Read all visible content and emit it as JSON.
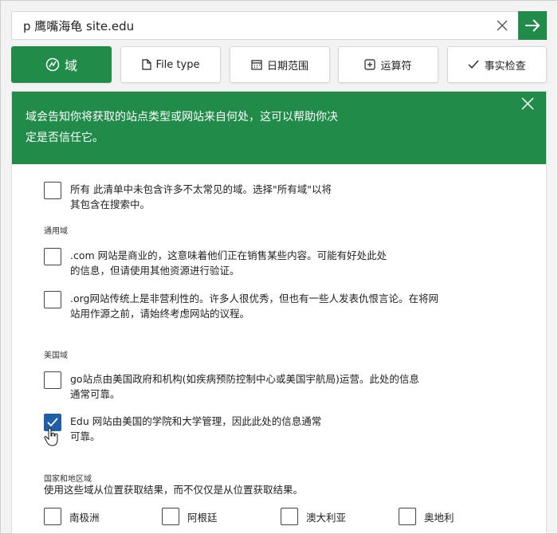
{
  "search": {
    "query": "p 鹰嘴海龟 site.edu"
  },
  "filters": [
    {
      "label": "域",
      "icon": "domain-icon"
    },
    {
      "label": "File type",
      "icon": "file-icon"
    },
    {
      "label": "日期范围",
      "icon": "calendar-icon"
    },
    {
      "label": "运算符",
      "icon": "plus-box-icon"
    },
    {
      "label": "事实检查",
      "icon": "checkmark-icon"
    }
  ],
  "banner": {
    "text": "域会告知你将获取的站点类型或网站来自何处，这可以帮助你决定是否信任它。"
  },
  "options": {
    "all": {
      "text": "所有 此清单中未包含许多不太常见的域。选择\"所有域\"以将其包含在搜索中。",
      "checked": false
    },
    "general_header": "通用域",
    "com": {
      "text": ".com 网站是商业的，这意味着他们正在销售某些内容。可能有好处此处的信息，但请使用其他资源进行验证。",
      "checked": false
    },
    "org": {
      "text": ".org网站传统上是非营利性的。许多人很优秀，但也有一些人发表仇恨言论。在将网站用作源之前，请始终考虑网站的议程。",
      "checked": false
    },
    "us_header": "美国域",
    "gov": {
      "text": "go站点由美国政府和机构(如疾病预防控制中心或美国宇航局)运营。此处的信息通常可靠。",
      "checked": false
    },
    "edu": {
      "text": "Edu 网站由美国的学院和大学管理，因此此处的信息通常可靠。",
      "checked": true
    },
    "country_header": "国家和地区域",
    "country_desc": "使用这些域从位置获取结果，而不仅仅是从位置获取结果。",
    "countries": [
      "南极洲",
      "阿根廷",
      "澳大利亚",
      "奥地利"
    ]
  },
  "colors": {
    "accent": "#218c4a",
    "checkbox_checked": "#1f5fa8"
  }
}
